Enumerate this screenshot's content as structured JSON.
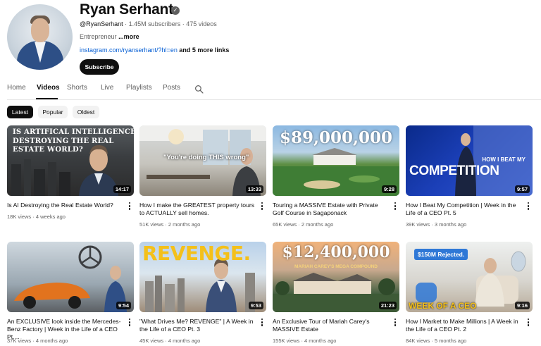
{
  "channel": {
    "name": "Ryan Serhant",
    "verified_icon": "verified-check-icon",
    "handle": "@RyanSerhant",
    "stats": " · 1.45M subscribers · 475 videos",
    "description": "Entrepreneur",
    "more_label": "...more",
    "link": "instagram.com/ryanserhant/?hl=en",
    "more_links": " and 5 more links",
    "subscribe_label": "Subscribe"
  },
  "tabs": [
    "Home",
    "Videos",
    "Shorts",
    "Live",
    "Playlists",
    "Posts"
  ],
  "active_tab": "Videos",
  "search_icon": "search-icon",
  "chips": [
    "Latest",
    "Popular",
    "Oldest"
  ],
  "active_chip": "Latest",
  "videos": [
    {
      "title": "Is AI Destroying the Real Estate World?",
      "views": "18K views",
      "age": "4 weeks ago",
      "duration": "14:17",
      "thumb_text": "IS ARTIFICAL INTELLIGENCE DESTROYING THE REAL ESTATE WORLD?"
    },
    {
      "title": "How I make the GREATEST property tours to ACTUALLY sell homes.",
      "views": "51K views",
      "age": "2 months ago",
      "duration": "13:33",
      "thumb_text": "\"You're doing THIS wrong\""
    },
    {
      "title": "Touring a MASSIVE Estate with Private Golf Course in Sagaponack",
      "views": "65K views",
      "age": "2 months ago",
      "duration": "9:28",
      "thumb_text": "$89,000,000"
    },
    {
      "title": "How I Beat My Competition | Week in the Life of a CEO Pt. 5",
      "views": "39K views",
      "age": "3 months ago",
      "duration": "9:57",
      "thumb_text": "HOW I BEAT MY",
      "thumb_text_2": "COMPETITION"
    },
    {
      "title": "An EXCLUSIVE look inside the Mercedes-Benz Factory | Week in the Life of a CEO Pt....",
      "views": "37K views",
      "age": "4 months ago",
      "duration": "9:54"
    },
    {
      "title": "\"What Drives Me? REVENGE\" | A Week in the Life of a CEO Pt. 3",
      "views": "45K views",
      "age": "4 months ago",
      "duration": "9:53",
      "thumb_text": "REVENGE."
    },
    {
      "title": "An Exclusive Tour of Mariah Carey's MASSIVE Estate",
      "views": "155K views",
      "age": "4 months ago",
      "duration": "21:23",
      "thumb_text": "$12,400,000",
      "thumb_text_2": "MARIAH CAREY'S MEGA COMPOUND"
    },
    {
      "title": "How I Market to Make Millions | A Week in the Life of a CEO Pt. 2",
      "views": "84K views",
      "age": "5 months ago",
      "duration": "9:16",
      "thumb_text": "$150M Rejected.",
      "thumb_text_2": "WEEK OF A CEO"
    }
  ]
}
